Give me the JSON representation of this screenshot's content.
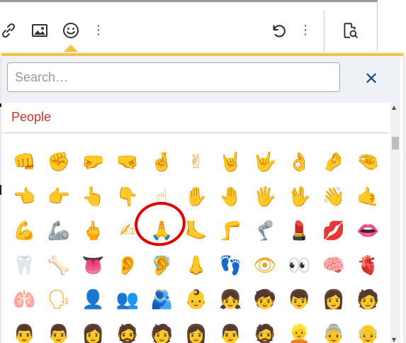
{
  "toolbar": {
    "buttons": [
      {
        "icon": "link-icon"
      },
      {
        "icon": "image-icon"
      },
      {
        "icon": "smiley-icon"
      },
      {
        "icon": "more-vertical-icon"
      },
      {
        "icon": "undo-icon"
      },
      {
        "icon": "more-vertical-icon"
      },
      {
        "icon": "preview-icon"
      }
    ]
  },
  "popup": {
    "search": {
      "placeholder": "Search…",
      "value": ""
    },
    "close_label": "✕",
    "category": "People",
    "emojis": [
      "👊",
      "✊",
      "🤛",
      "🤜",
      "🤞",
      "✌",
      "🤘",
      "🤟",
      "👌",
      "🤌",
      "🤏",
      "👈",
      "👉",
      "👆",
      "👇",
      "☝",
      "✋",
      "🤚",
      "🖐",
      "🖖",
      "👋",
      "🤙",
      "💪",
      "🦾",
      "🖕",
      "✍",
      "🙏",
      "🦶",
      "🦵",
      "🦿",
      "💄",
      "💋",
      "👄",
      "🦷",
      "🦴",
      "👅",
      "👂",
      "🦻",
      "👃",
      "👣",
      "👁",
      "👀",
      "🧠",
      "🫀",
      "🫁",
      "🗣",
      "👤",
      "👥",
      "🫂",
      "👶",
      "👧",
      "🧒",
      "👦",
      "👩",
      "🧑",
      "👨",
      "👨",
      "👩",
      "🧔",
      "🧑",
      "👩",
      "👨",
      "🧔",
      "👱",
      "👵",
      "👴"
    ]
  },
  "colors": {
    "accent": "#f5c342",
    "category": "#c0392b",
    "close": "#1f4f8b",
    "highlight": "#e00000"
  }
}
